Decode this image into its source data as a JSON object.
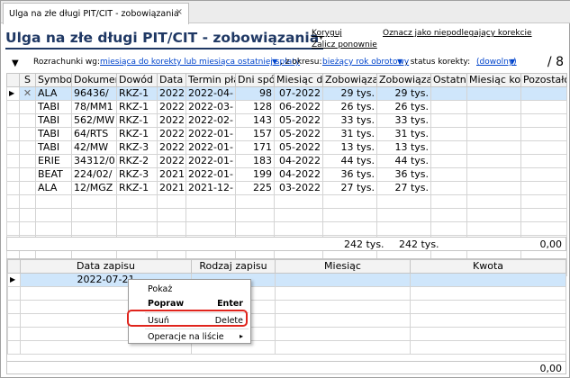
{
  "tab": {
    "label": "Ulga na złe długi PIT/CIT - zobowiązania",
    "close": "×"
  },
  "header": {
    "title": "Ulga na złe długi PIT/CIT - zobowiązania",
    "actions": {
      "koryguj": "Koryguj",
      "zalicz": "Zalicz ponownie",
      "oznacz": "Oznacz jako niepodlegający korekcie"
    }
  },
  "filters": {
    "arrow": "▼",
    "rozr_label": "Rozrachunki wg:",
    "rozr_value": "miesiąca do korekty lub miesiąca ostatniej spłaty",
    "okres_label": ", z okresu:",
    "okres_value": "bieżący rok obrotowy",
    "status_label": ", status korekty:",
    "status_value": "(dowolny)",
    "count": "/ 8"
  },
  "grid": {
    "columns": [
      "",
      "S",
      "Symbol",
      "Dokument",
      "Dowód k",
      "Data p",
      "Termin płat",
      "Dni spó",
      "Miesiąc do",
      "Zobowiąza",
      "Zobowiąza",
      "Ostatni",
      "Miesiąc ko",
      "Pozostało"
    ],
    "rows": [
      {
        "s": "✕",
        "symbol": "ALA",
        "dok": "96436/",
        "dowod": "RKZ-1",
        "data": "2022",
        "termin": "2022-04-",
        "dni": "98",
        "mies": "07-2022",
        "z1": "29 tys.",
        "z2": "29 tys.",
        "selected": true
      },
      {
        "s": "",
        "symbol": "TABI",
        "dok": "78/MM1",
        "dowod": "RKZ-1",
        "data": "2022",
        "termin": "2022-03-",
        "dni": "128",
        "mies": "06-2022",
        "z1": "26 tys.",
        "z2": "26 tys."
      },
      {
        "s": "",
        "symbol": "TABI",
        "dok": "562/MW",
        "dowod": "RKZ-1",
        "data": "2022",
        "termin": "2022-02-",
        "dni": "143",
        "mies": "05-2022",
        "z1": "33 tys.",
        "z2": "33 tys."
      },
      {
        "s": "",
        "symbol": "TABI",
        "dok": "64/RTS",
        "dowod": "RKZ-1",
        "data": "2022",
        "termin": "2022-01-",
        "dni": "157",
        "mies": "05-2022",
        "z1": "31 tys.",
        "z2": "31 tys."
      },
      {
        "s": "",
        "symbol": "TABI",
        "dok": "42/MW",
        "dowod": "RKZ-3",
        "data": "2022",
        "termin": "2022-01-",
        "dni": "171",
        "mies": "05-2022",
        "z1": "13 tys.",
        "z2": "13 tys."
      },
      {
        "s": "",
        "symbol": "ERIE",
        "dok": "34312/0",
        "dowod": "RKZ-2",
        "data": "2022",
        "termin": "2022-01-",
        "dni": "183",
        "mies": "04-2022",
        "z1": "44 tys.",
        "z2": "44 tys."
      },
      {
        "s": "",
        "symbol": "BEAT",
        "dok": "224/02/",
        "dowod": "RKZ-3",
        "data": "2021",
        "termin": "2022-01-",
        "dni": "199",
        "mies": "04-2022",
        "z1": "36 tys.",
        "z2": "36 tys."
      },
      {
        "s": "",
        "symbol": "ALA",
        "dok": "12/MGZ",
        "dowod": "RKZ-1",
        "data": "2021",
        "termin": "2021-12-",
        "dni": "225",
        "mies": "03-2022",
        "z1": "27 tys.",
        "z2": "27 tys."
      }
    ],
    "sum1": "242 tys.",
    "sum2": "242 tys.",
    "sum3": "0,00"
  },
  "lower": {
    "columns": [
      "",
      "Data zapisu",
      "Rodzaj zapisu",
      "Miesiąc",
      "Kwota"
    ],
    "row": {
      "data": "2022-07-21"
    },
    "total": "0,00"
  },
  "menu": {
    "pokaz": "Pokaż",
    "popraw": "Popraw",
    "popraw_key": "Enter",
    "usun": "Usuń",
    "usun_key": "Delete",
    "operacje": "Operacje na liście",
    "arrow": "▸"
  }
}
